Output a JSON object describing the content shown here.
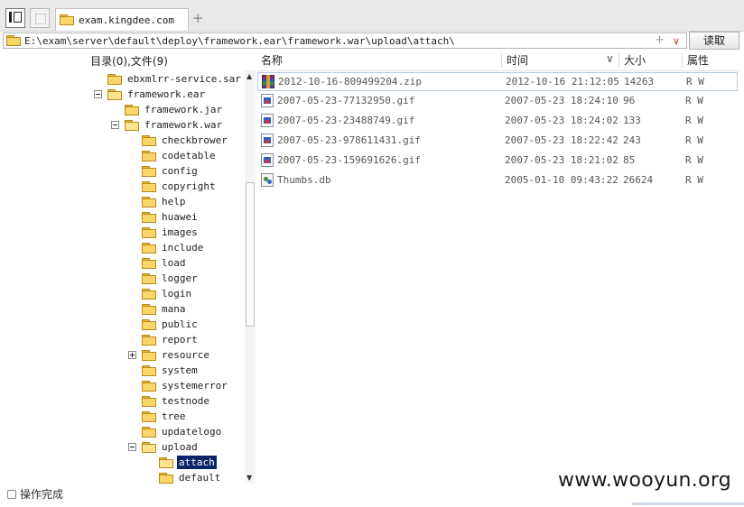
{
  "tabs": [
    {
      "title": "exam.kingdee.com"
    }
  ],
  "address": {
    "path": "E:\\exam\\server\\default\\deploy\\framework.ear\\framework.war\\upload\\attach\\",
    "plus_glyph": "+",
    "dropdown_glyph": "∨"
  },
  "read_button": "读取",
  "tree": {
    "header": "目录(0),文件(9)",
    "nodes": [
      {
        "name": "ebxmlrr-service.sar",
        "depth": 0,
        "expander": null,
        "open": false,
        "selected": false
      },
      {
        "name": "framework.ear",
        "depth": 0,
        "expander": "minus",
        "open": true,
        "selected": false
      },
      {
        "name": "framework.jar",
        "depth": 1,
        "expander": null,
        "open": false,
        "selected": false
      },
      {
        "name": "framework.war",
        "depth": 1,
        "expander": "minus",
        "open": true,
        "selected": false
      },
      {
        "name": "checkbrower",
        "depth": 2,
        "expander": null,
        "open": false,
        "selected": false
      },
      {
        "name": "codetable",
        "depth": 2,
        "expander": null,
        "open": false,
        "selected": false
      },
      {
        "name": "config",
        "depth": 2,
        "expander": null,
        "open": false,
        "selected": false
      },
      {
        "name": "copyright",
        "depth": 2,
        "expander": null,
        "open": false,
        "selected": false
      },
      {
        "name": "help",
        "depth": 2,
        "expander": null,
        "open": false,
        "selected": false
      },
      {
        "name": "huawei",
        "depth": 2,
        "expander": null,
        "open": false,
        "selected": false
      },
      {
        "name": "images",
        "depth": 2,
        "expander": null,
        "open": false,
        "selected": false
      },
      {
        "name": "include",
        "depth": 2,
        "expander": null,
        "open": false,
        "selected": false
      },
      {
        "name": "load",
        "depth": 2,
        "expander": null,
        "open": false,
        "selected": false
      },
      {
        "name": "logger",
        "depth": 2,
        "expander": null,
        "open": false,
        "selected": false
      },
      {
        "name": "login",
        "depth": 2,
        "expander": null,
        "open": false,
        "selected": false
      },
      {
        "name": "mana",
        "depth": 2,
        "expander": null,
        "open": false,
        "selected": false
      },
      {
        "name": "public",
        "depth": 2,
        "expander": null,
        "open": false,
        "selected": false
      },
      {
        "name": "report",
        "depth": 2,
        "expander": null,
        "open": false,
        "selected": false
      },
      {
        "name": "resource",
        "depth": 2,
        "expander": "plus",
        "open": false,
        "selected": false
      },
      {
        "name": "system",
        "depth": 2,
        "expander": null,
        "open": false,
        "selected": false
      },
      {
        "name": "systemerror",
        "depth": 2,
        "expander": null,
        "open": false,
        "selected": false
      },
      {
        "name": "testnode",
        "depth": 2,
        "expander": null,
        "open": false,
        "selected": false
      },
      {
        "name": "tree",
        "depth": 2,
        "expander": null,
        "open": false,
        "selected": false
      },
      {
        "name": "updatelogo",
        "depth": 2,
        "expander": null,
        "open": false,
        "selected": false
      },
      {
        "name": "upload",
        "depth": 2,
        "expander": "minus",
        "open": true,
        "selected": false
      },
      {
        "name": "attach",
        "depth": 3,
        "expander": null,
        "open": true,
        "selected": true
      },
      {
        "name": "default",
        "depth": 3,
        "expander": null,
        "open": false,
        "selected": false
      }
    ]
  },
  "list": {
    "columns": {
      "name": "名称",
      "time": "时间",
      "size": "大小",
      "attr": "属性"
    },
    "files": [
      {
        "icon": "zip-archive-icon",
        "name": "2012-10-16-809499204.zip",
        "time": "2012-10-16 21:12:05",
        "size": "14263",
        "attr": "R W"
      },
      {
        "icon": "gif-image-icon",
        "name": "2007-05-23-77132950.gif",
        "time": "2007-05-23 18:24:10",
        "size": "96",
        "attr": "R W"
      },
      {
        "icon": "gif-image-icon",
        "name": "2007-05-23-23488749.gif",
        "time": "2007-05-23 18:24:02",
        "size": "133",
        "attr": "R W"
      },
      {
        "icon": "gif-image-icon",
        "name": "2007-05-23-978611431.gif",
        "time": "2007-05-23 18:22:42",
        "size": "243",
        "attr": "R W"
      },
      {
        "icon": "gif-image-icon",
        "name": "2007-05-23-159691626.gif",
        "time": "2007-05-23 18:21:02",
        "size": "85",
        "attr": "R W"
      },
      {
        "icon": "db-file-icon",
        "name": "Thumbs.db",
        "time": "2005-01-10 09:43:22",
        "size": "26624",
        "attr": "R W"
      }
    ]
  },
  "status": {
    "text": "操作完成"
  },
  "watermark": "www.wooyun.org"
}
